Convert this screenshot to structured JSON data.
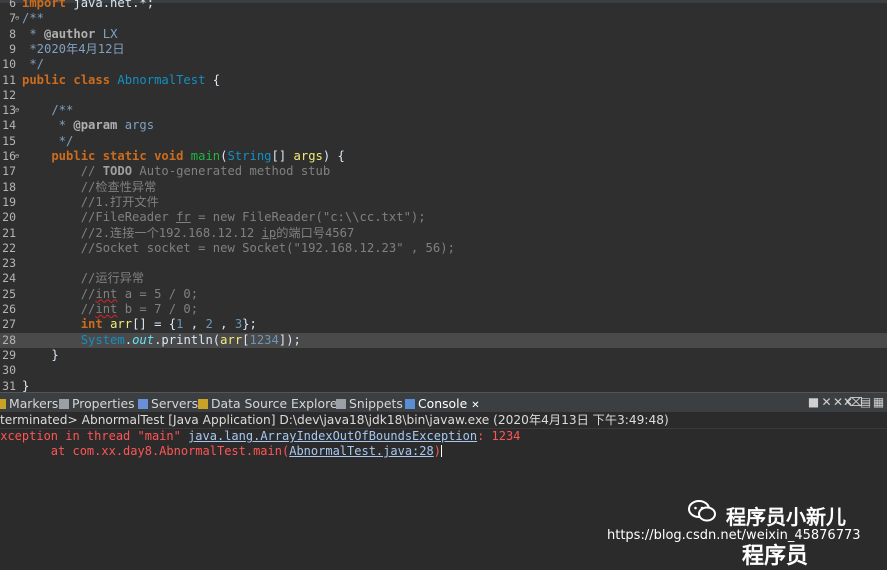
{
  "editor": {
    "lines": [
      {
        "n": "6",
        "parts": [
          [
            "kw",
            "import "
          ],
          [
            "t",
            "java.net.*;"
          ]
        ]
      },
      {
        "n": "7",
        "fold": true,
        "parts": [
          [
            "jd",
            "/**"
          ]
        ]
      },
      {
        "n": "8",
        "parts": [
          [
            "jd",
            " * "
          ],
          [
            "tag",
            "@author"
          ],
          [
            "jd",
            " LX"
          ]
        ]
      },
      {
        "n": "9",
        "parts": [
          [
            "jd",
            " *2020年4月12日"
          ]
        ]
      },
      {
        "n": "10",
        "parts": [
          [
            "jd",
            " */"
          ]
        ]
      },
      {
        "n": "11",
        "parts": [
          [
            "kw",
            "public class "
          ],
          [
            "ty",
            "AbnormalTest"
          ],
          [
            "t",
            " {"
          ]
        ]
      },
      {
        "n": "12",
        "parts": []
      },
      {
        "n": "13",
        "fold": true,
        "parts": [
          [
            "jd",
            "    /**"
          ]
        ]
      },
      {
        "n": "14",
        "parts": [
          [
            "jd",
            "     * "
          ],
          [
            "tag",
            "@param"
          ],
          [
            "jd",
            " args"
          ]
        ]
      },
      {
        "n": "15",
        "parts": [
          [
            "jd",
            "     */"
          ]
        ]
      },
      {
        "n": "16",
        "fold": true,
        "parts": [
          [
            "kw",
            "    public static void "
          ],
          [
            "fn",
            "main"
          ],
          [
            "t",
            "("
          ],
          [
            "ty",
            "String"
          ],
          [
            "t",
            "[] "
          ],
          [
            "var",
            "args"
          ],
          [
            "t",
            ") {"
          ]
        ]
      },
      {
        "n": "17",
        "parts": [
          [
            "cm",
            "        // "
          ],
          [
            "todo",
            "TODO"
          ],
          [
            "cm",
            " Auto-generated method stub"
          ]
        ]
      },
      {
        "n": "18",
        "parts": [
          [
            "cm",
            "        //检查性异常"
          ]
        ]
      },
      {
        "n": "19",
        "parts": [
          [
            "cm",
            "        //1.打开文件"
          ]
        ]
      },
      {
        "n": "20",
        "parts": [
          [
            "cm",
            "        //FileReader "
          ],
          [
            "cmul",
            "fr"
          ],
          [
            "cm",
            " = new FileReader(\"c:\\\\cc.txt\");"
          ]
        ]
      },
      {
        "n": "21",
        "parts": [
          [
            "cm",
            "        //2.连接一个192.168.12.12 "
          ],
          [
            "cmul",
            "ip"
          ],
          [
            "cm",
            "的端口号4567"
          ]
        ]
      },
      {
        "n": "22",
        "parts": [
          [
            "cm",
            "        //Socket socket = new Socket(\"192.168.12.23\" , 56);"
          ]
        ]
      },
      {
        "n": "23",
        "parts": []
      },
      {
        "n": "24",
        "parts": [
          [
            "cm",
            "        //运行异常"
          ]
        ]
      },
      {
        "n": "25",
        "parts": [
          [
            "cm",
            "        //"
          ],
          [
            "cmsq",
            "int"
          ],
          [
            "cm",
            " a = 5 / 0;"
          ]
        ]
      },
      {
        "n": "26",
        "parts": [
          [
            "cm",
            "        //"
          ],
          [
            "cmsq",
            "int"
          ],
          [
            "cm",
            " b = 7 / 0;"
          ]
        ]
      },
      {
        "n": "27",
        "parts": [
          [
            "kw",
            "        int "
          ],
          [
            "var",
            "arr"
          ],
          [
            "t",
            "[] = {"
          ],
          [
            "num",
            "1"
          ],
          [
            "t",
            " , "
          ],
          [
            "num",
            "2"
          ],
          [
            "t",
            " , "
          ],
          [
            "num",
            "3"
          ],
          [
            "t",
            "};"
          ]
        ]
      },
      {
        "n": "28",
        "current": true,
        "parts": [
          [
            "ty",
            "        System"
          ],
          [
            "t",
            "."
          ],
          [
            "fld",
            "out"
          ],
          [
            "t",
            ".println("
          ],
          [
            "var",
            "arr"
          ],
          [
            "t",
            "["
          ],
          [
            "num",
            "1234"
          ],
          [
            "t",
            "]);"
          ]
        ]
      },
      {
        "n": "29",
        "parts": [
          [
            "t",
            "    }"
          ]
        ]
      },
      {
        "n": "30",
        "parts": []
      },
      {
        "n": "31",
        "parts": [
          [
            "t",
            "}"
          ]
        ]
      }
    ]
  },
  "views": {
    "tabs": [
      {
        "label": "Markers",
        "name": "tab-markers",
        "icon": "markers-icon",
        "color": "#c9a227",
        "active": false
      },
      {
        "label": "Properties",
        "name": "tab-properties",
        "icon": "properties-icon",
        "color": "#9aa0a6",
        "active": false
      },
      {
        "label": "Servers",
        "name": "tab-servers",
        "icon": "servers-icon",
        "color": "#6a8fd8",
        "active": false
      },
      {
        "label": "Data Source Explorer",
        "name": "tab-data-source-explorer",
        "icon": "database-icon",
        "color": "#c9a227",
        "active": false
      },
      {
        "label": "Snippets",
        "name": "tab-snippets",
        "icon": "snippets-icon",
        "color": "#9aa0a6",
        "active": false
      },
      {
        "label": "Console",
        "name": "tab-console",
        "icon": "console-icon",
        "color": "#5b8dd6",
        "active": true
      }
    ],
    "console_close": "✕",
    "tools": [
      "■",
      "✕",
      "✕✕",
      "⌫",
      "▤",
      "▦"
    ]
  },
  "console": {
    "title": "terminated> AbnormalTest [Java Application] D:\\dev\\java18\\jdk18\\bin\\javaw.exe (2020年4月13日 下午3:49:48)",
    "line1_prefix": "Exception in thread \"main\" ",
    "line1_link": "java.lang.ArrayIndexOutOfBoundsException",
    "line1_suffix": ": 1234",
    "line2_prefix": "\tat com.xx.day8.AbnormalTest.main(",
    "line2_link": "AbnormalTest.java:28",
    "line2_suffix": ")"
  },
  "watermark": {
    "name": "程序员小新儿",
    "url": "https://blog.csdn.net/weixin_45876773",
    "bottom": "程序员"
  }
}
